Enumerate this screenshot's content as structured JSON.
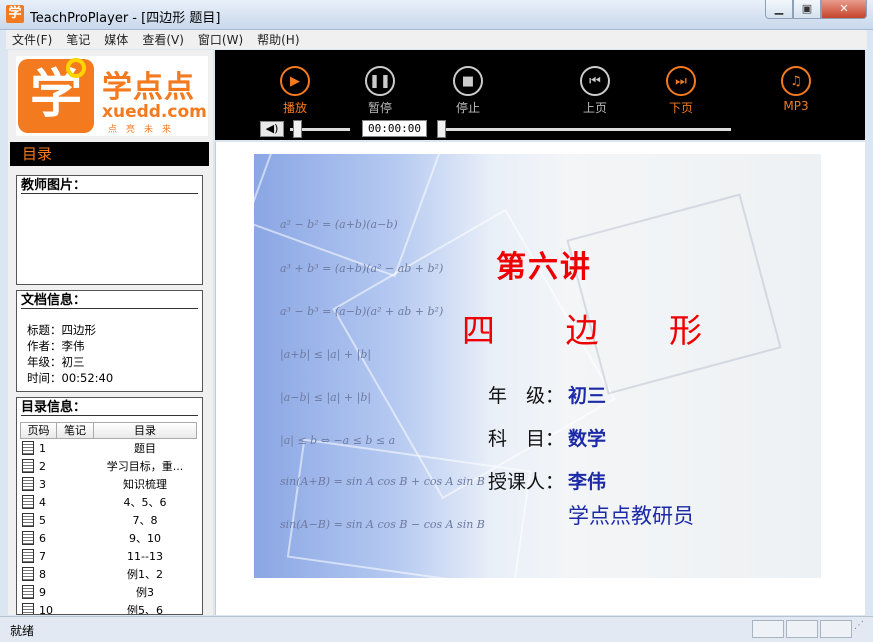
{
  "window": {
    "app_icon": "学",
    "title": "TeachProPlayer - [四边形 题目]",
    "buttons": [
      "minimize-icon",
      "maximize-icon",
      "close-icon"
    ]
  },
  "menu": [
    "文件(F)",
    "笔记",
    "媒体",
    "查看(V)",
    "窗口(W)",
    "帮助(H)"
  ],
  "logo": {
    "mark": "学",
    "cn": "学点点",
    "url": "xuedd.com",
    "slogan": "点亮未来",
    "color": "#f47a1f"
  },
  "sidebar": {
    "header": "目录",
    "teacher": {
      "title": "教师图片："
    },
    "doc_info": {
      "title": "文档信息：",
      "rows": [
        {
          "label": "标题：",
          "value": "四边形"
        },
        {
          "label": "作者：",
          "value": "李伟"
        },
        {
          "label": "年级：",
          "value": "初三"
        },
        {
          "label": "时间：",
          "value": "00:52:40"
        }
      ]
    },
    "toc": {
      "title": "目录信息：",
      "columns": [
        "页码",
        "笔记",
        "目录"
      ],
      "rows": [
        {
          "page": "1",
          "title": "题目"
        },
        {
          "page": "2",
          "title": "学习目标，重..."
        },
        {
          "page": "3",
          "title": "知识梳理"
        },
        {
          "page": "4",
          "title": "4、5、6"
        },
        {
          "page": "5",
          "title": "7、8"
        },
        {
          "page": "6",
          "title": "9、10"
        },
        {
          "page": "7",
          "title": "11--13"
        },
        {
          "page": "8",
          "title": "例1、2"
        },
        {
          "page": "9",
          "title": "例3"
        },
        {
          "page": "10",
          "title": "例5、6"
        }
      ]
    }
  },
  "player": {
    "controls": [
      {
        "id": "play",
        "label": "播放",
        "icon": "play-icon",
        "glyph": "▶",
        "active": true
      },
      {
        "id": "pause",
        "label": "暂停",
        "icon": "pause-icon",
        "glyph": "❚❚",
        "active": false
      },
      {
        "id": "stop",
        "label": "停止",
        "icon": "stop-icon",
        "glyph": "■",
        "active": false
      },
      {
        "id": "prev",
        "label": "上页",
        "icon": "previous-page-icon",
        "glyph": "⏮",
        "active": false
      },
      {
        "id": "next",
        "label": "下页",
        "icon": "next-page-icon",
        "glyph": "⏭",
        "active": true
      },
      {
        "id": "mp3",
        "label": "MP3",
        "icon": "music-icon",
        "glyph": "♫",
        "active": true
      }
    ],
    "time": "00:00:00",
    "volume_icon": "speaker-icon",
    "volume_level": 0.1,
    "progress": 0.0
  },
  "slide": {
    "formulas": [
      "a² − b² = (a+b)(a−b)",
      "a³ + b³ = (a+b)(a² − ab + b²)",
      "a³ − b³ = (a−b)(a² + ab + b²)",
      "|a+b| ≤ |a| + |b|",
      "|a−b| ≤ |a| + |b|",
      "|a| ≤ b ⇔ −a ≤ b ≤ a",
      "sin(A+B) = sin A cos B + cos A sin B",
      "sin(A−B) = sin A cos B − cos A sin B"
    ],
    "lecture": "第六讲",
    "topic": "四 边 形",
    "grade_label": "年　级：",
    "grade": "初三",
    "subject_label": "科　目：",
    "subject": "数学",
    "teacher_label": "授课人：",
    "teacher": "李伟",
    "team": "学点点教研员"
  },
  "status": {
    "text": "就绪"
  }
}
